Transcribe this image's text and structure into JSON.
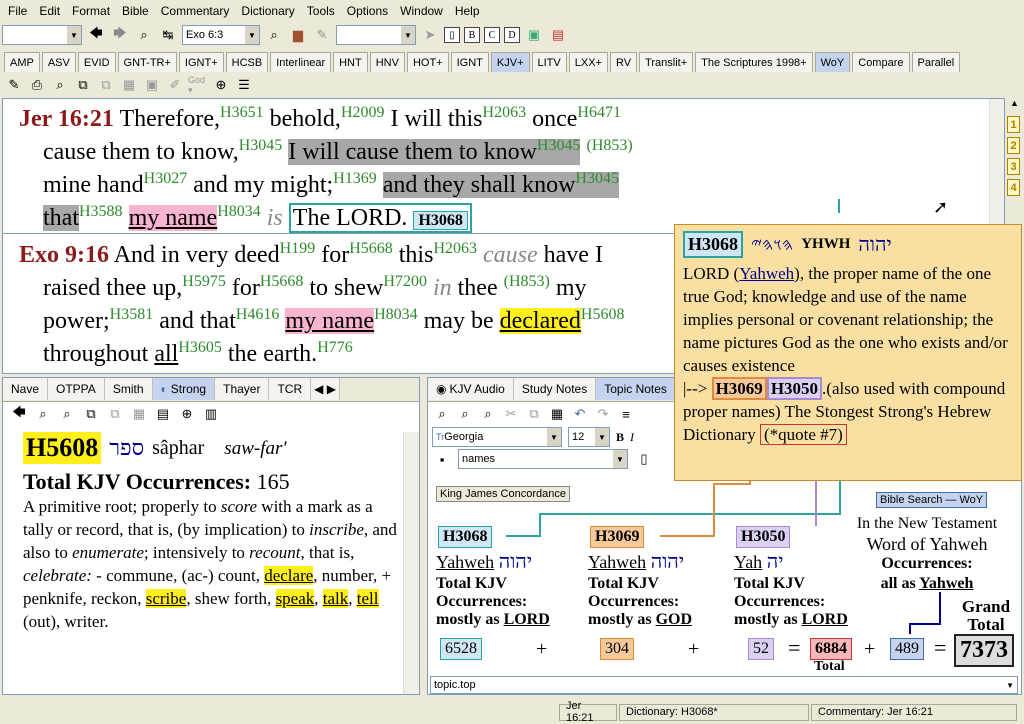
{
  "menu": [
    "File",
    "Edit",
    "Format",
    "Bible",
    "Commentary",
    "Dictionary",
    "Tools",
    "Options",
    "Window",
    "Help"
  ],
  "toolbar": {
    "ref_value": "Exo 6:3"
  },
  "bible_tabs": [
    "AMP",
    "ASV",
    "EVID",
    "GNT-TR+",
    "IGNT+",
    "HCSB",
    "Interlinear",
    "HNT",
    "HNV",
    "HOT+",
    "IGNT",
    "KJV+",
    "LITV",
    "LXX+",
    "RV",
    "Translit+",
    "The Scriptures 1998+",
    "WoY",
    "Compare",
    "Parallel"
  ],
  "active_bible_tab": "KJV+",
  "verse1": {
    "ref": "Jer 16:21",
    "w1": "Therefore,",
    "s1": "H3651",
    "w2": "behold,",
    "s2": "H2009",
    "w3": "I will this",
    "s3": "H2063",
    "w4": "once",
    "s4": "H6471",
    "w5": "cause them to",
    "w6": "know,",
    "s5": "H3045",
    "w7": "I will cause them to know",
    "s6": "H3045",
    "s6b": "(H853)",
    "w8": "mine hand",
    "s7": "H3027",
    "w9": "and my",
    "w10": "might;",
    "s8": "H1369",
    "w11": "and they shall know",
    "s9": "H3045",
    "w12": "that",
    "s10": "H3588",
    "w13": "my name",
    "s11": "H8034",
    "w14": "is",
    "w15": "The LORD.",
    "s12": "H3068"
  },
  "verse2": {
    "ref": "Exo 9:16",
    "w1": "And in very deed",
    "s1": "H199",
    "w2": "for",
    "s2": "H5668",
    "w3": "this",
    "s3": "H2063",
    "w4": "cause",
    "w5": "have I raised thee up,",
    "s4": "H5975",
    "w6": "for",
    "s5": "H5668",
    "w7": "to shew",
    "s6": "H7200",
    "w8": "in",
    "w9": "thee",
    "s7": "(H853)",
    "w10": "my power;",
    "s8": "H3581",
    "w11": "and that",
    "s9": "H4616",
    "w12": "my name",
    "s10": "H8034",
    "w13": "may",
    "w14": "be",
    "w15": "declared",
    "s11": "H5608",
    "w16": "throughout",
    "w17": "all",
    "s12": "H3605",
    "w18": "the earth.",
    "s13": "H776"
  },
  "popup": {
    "code": "H3068",
    "paleo": "𐤄𐤅𐤄𐤉",
    "translit": "YHWH",
    "hebrew": "יהוה",
    "def1": "LORD (",
    "def_link": "Yahweh",
    "def2": "), the proper name of the one true God; knowledge and use of the name implies personal or covenant relationship; the name pictures God as the one who exists and/or causes existence",
    "arrow": "|-->",
    "ref1": "H3069",
    "ref2": "H3050",
    "def3": ".(also used with compound proper names) The Stongest Strong's Hebrew Dictionary",
    "quote": "(*quote #7)"
  },
  "left_tabs": [
    "Nave",
    "OTPPA",
    "Smith",
    "Strong",
    "Thayer",
    "TCR"
  ],
  "active_left_tab": "Strong",
  "dictionary": {
    "code": "H5608",
    "hebrew": "ספר",
    "translit": "sâphar",
    "pron": "saw-far'",
    "occ_label": "Total KJV Occurrences:",
    "occ_value": "165",
    "def_a": "A primitive root; properly to ",
    "def_score": "score",
    "def_b": " with a mark as a tally or record, that is, (by implication) to ",
    "def_inscribe": "inscribe",
    "def_c": ", and also to ",
    "def_enumerate": "enumerate",
    "def_d": "; intensively to ",
    "def_recount": "recount",
    "def_e": ", that is, ",
    "def_celebrate": "celebrate:",
    "def_f": " - commune, (ac-) count,",
    "hl_declare": "declare",
    "def_g": ", number, + penknife, reckon,",
    "hl_scribe": "scribe",
    "def_h": ", shew forth, ",
    "hl_speak": "speak",
    "hl_talk": "talk",
    "hl_tell": "tell",
    "def_i": "(out), writer."
  },
  "right_tabs": [
    "KJV Audio",
    "Study Notes",
    "Topic Notes"
  ],
  "active_right_tab": "Topic Notes",
  "editor": {
    "font": "Georgia",
    "size": "12",
    "style": "names",
    "file": "topic.top"
  },
  "concordance": {
    "title": "King James Concordance",
    "bible_search": "Bible Search — WoY",
    "nt_line1": "In the New Testament",
    "nt_line2": "Word of Yahweh",
    "nt_line3": "Occurrences:",
    "nt_line4": "all as ",
    "nt_name": "Yahweh",
    "col1": {
      "code": "H3068",
      "name": "Yahweh",
      "heb": "יהוה",
      "l1": "Total KJV",
      "l2": "Occurrences:",
      "l3": "mostly as ",
      "as": "LORD",
      "count": "6528"
    },
    "col2": {
      "code": "H3069",
      "name": "Yahweh",
      "heb": "יהוה",
      "l1": "Total KJV",
      "l2": "Occurrences:",
      "l3": "mostly as ",
      "as": "GOD",
      "count": "304"
    },
    "col3": {
      "code": "H3050",
      "name": "Yah",
      "heb": "יה",
      "l1": "Total KJV",
      "l2": "Occurrences:",
      "l3": "mostly as ",
      "as": "LORD",
      "count": "52"
    },
    "plus": "+",
    "equals": "=",
    "total": "6884",
    "total_label": "Total",
    "nt_count": "489",
    "grand_label1": "Grand",
    "grand_label2": "Total",
    "grand_total": "7373"
  },
  "status": {
    "verse": "Jer 16:21",
    "dictionary": "Dictionary: H3068*",
    "commentary": "Commentary: Jer 16:21"
  }
}
